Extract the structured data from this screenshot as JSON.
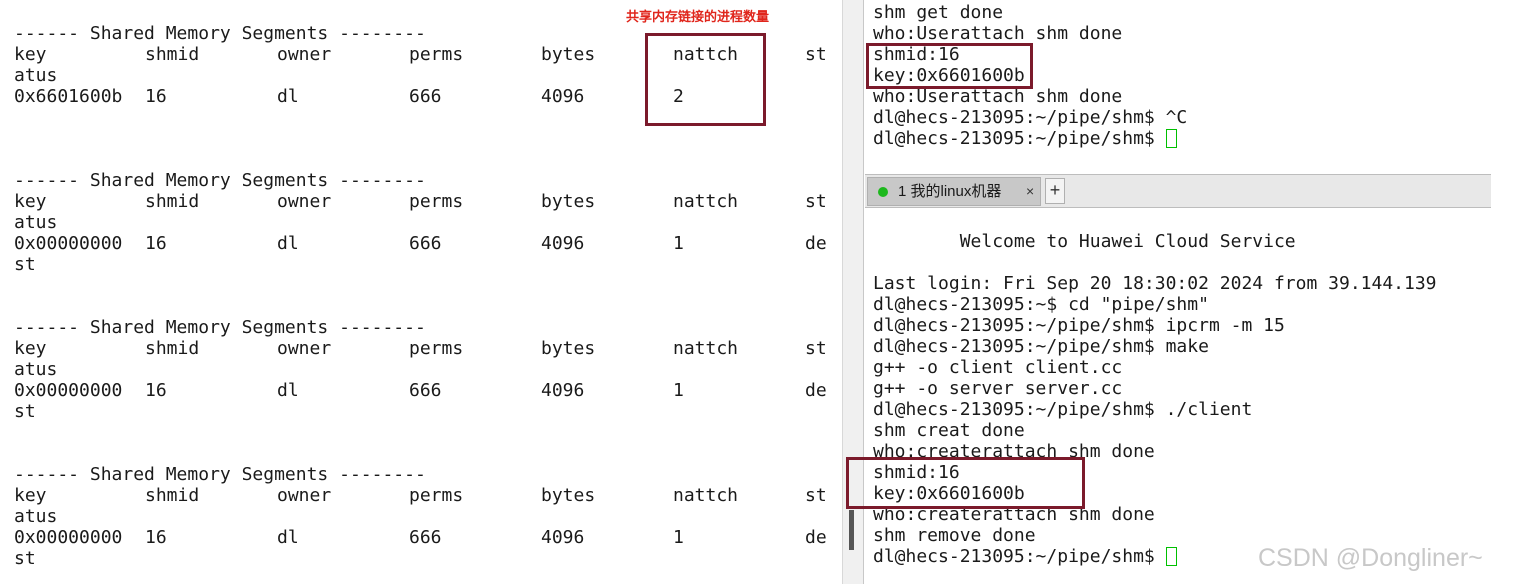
{
  "left_pane": {
    "blocks": [
      {
        "header": "------ Shared Memory Segments --------",
        "columns": [
          "key",
          "shmid",
          "owner",
          "perms",
          "bytes",
          "nattch",
          "st"
        ],
        "columns_wrap": "atus",
        "row": [
          "0x6601600b",
          "16",
          "dl",
          "666",
          "4096",
          "2",
          ""
        ],
        "row_wrap": ""
      },
      {
        "header": "------ Shared Memory Segments --------",
        "columns": [
          "key",
          "shmid",
          "owner",
          "perms",
          "bytes",
          "nattch",
          "st"
        ],
        "columns_wrap": "atus",
        "row": [
          "0x00000000",
          "16",
          "dl",
          "666",
          "4096",
          "1",
          "de"
        ],
        "row_wrap": "st"
      },
      {
        "header": "------ Shared Memory Segments --------",
        "columns": [
          "key",
          "shmid",
          "owner",
          "perms",
          "bytes",
          "nattch",
          "st"
        ],
        "columns_wrap": "atus",
        "row": [
          "0x00000000",
          "16",
          "dl",
          "666",
          "4096",
          "1",
          "de"
        ],
        "row_wrap": "st"
      },
      {
        "header": "------ Shared Memory Segments --------",
        "columns": [
          "key",
          "shmid",
          "owner",
          "perms",
          "bytes",
          "nattch",
          "st"
        ],
        "columns_wrap": "atus",
        "row": [
          "0x00000000",
          "16",
          "dl",
          "666",
          "4096",
          "1",
          "de"
        ],
        "row_wrap": "st"
      }
    ]
  },
  "annotation": {
    "text": "共享内存链接的进程数量",
    "color": "#e0261c",
    "box_color": "#7b1a2b"
  },
  "right_top": {
    "lines": [
      "shm get done",
      "who:Userattach shm done",
      "shmid:16",
      "key:0x6601600b",
      "who:Userattach shm done",
      "dl@hecs-213095:~/pipe/shm$ ^C",
      "dl@hecs-213095:~/pipe/shm$ "
    ]
  },
  "tab_bar": {
    "tab_label": "1 我的linux机器",
    "tab_close": "×",
    "new_tab": "+",
    "status_color": "#1db81d"
  },
  "right_bottom": {
    "lines": [
      "",
      "        Welcome to Huawei Cloud Service",
      "",
      "Last login: Fri Sep 20 18:30:02 2024 from 39.144.139",
      "dl@hecs-213095:~$ cd \"pipe/shm\"",
      "dl@hecs-213095:~/pipe/shm$ ipcrm -m 15",
      "dl@hecs-213095:~/pipe/shm$ make",
      "g++ -o client client.cc",
      "g++ -o server server.cc",
      "dl@hecs-213095:~/pipe/shm$ ./client",
      "shm creat done",
      "who:createrattach shm done",
      "shmid:16",
      "key:0x6601600b",
      "who:createrattach shm done",
      "shm remove done",
      "dl@hecs-213095:~/pipe/shm$ "
    ]
  },
  "watermark": "CSDN @Dongliner~",
  "colors": {
    "cursor": "#00c000",
    "text": "#1a1a1a"
  }
}
